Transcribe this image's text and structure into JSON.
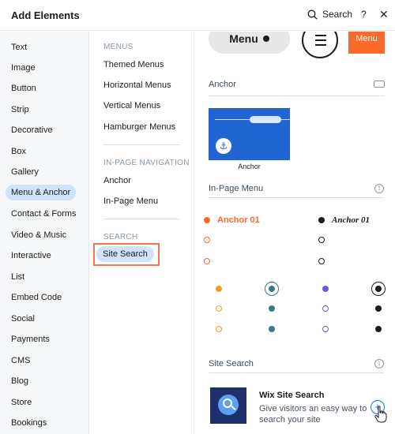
{
  "header": {
    "title": "Add Elements",
    "search_label": "Search",
    "help_label": "?",
    "close_label": "✕"
  },
  "categories": [
    {
      "label": "Text",
      "selected": false
    },
    {
      "label": "Image",
      "selected": false
    },
    {
      "label": "Button",
      "selected": false
    },
    {
      "label": "Strip",
      "selected": false
    },
    {
      "label": "Decorative",
      "selected": false
    },
    {
      "label": "Box",
      "selected": false
    },
    {
      "label": "Gallery",
      "selected": false
    },
    {
      "label": "Menu & Anchor",
      "selected": true
    },
    {
      "label": "Contact & Forms",
      "selected": false
    },
    {
      "label": "Video & Music",
      "selected": false
    },
    {
      "label": "Interactive",
      "selected": false
    },
    {
      "label": "List",
      "selected": false
    },
    {
      "label": "Embed Code",
      "selected": false
    },
    {
      "label": "Social",
      "selected": false
    },
    {
      "label": "Payments",
      "selected": false
    },
    {
      "label": "CMS",
      "selected": false
    },
    {
      "label": "Blog",
      "selected": false
    },
    {
      "label": "Store",
      "selected": false
    },
    {
      "label": "Bookings",
      "selected": false
    }
  ],
  "subcategories": {
    "menus_heading": "MENUS",
    "menus": [
      "Themed Menus",
      "Horizontal Menus",
      "Vertical Menus",
      "Hamburger Menus"
    ],
    "inpage_heading": "IN-PAGE NAVIGATION",
    "inpage": [
      "Anchor",
      "In-Page Menu"
    ],
    "search_heading": "SEARCH",
    "search_selected": "Site Search"
  },
  "preview": {
    "menu_pill_label": "Menu",
    "orange_menu_label": "Menu",
    "anchor_section": "Anchor",
    "anchor_caption": "Anchor",
    "anchor_icon": "⚓",
    "inpage_section": "In-Page Menu",
    "inpage_orange_label": "Anchor 01",
    "inpage_black_label": "Anchor 01",
    "site_search_section": "Site Search",
    "ss_title": "Wix Site Search",
    "ss_desc": "Give visitors an easy way to search your site",
    "info_glyph": "i",
    "add_glyph": "+"
  },
  "colors": {
    "accent_orange": "#fb6a2a",
    "anchor_blue": "#2065d1",
    "selected_bg": "#cfe3fd",
    "highlight_box": "#ef7856",
    "teal": "#3c7a8a",
    "purple": "#6a5cd6",
    "amber": "#f0a01a"
  }
}
